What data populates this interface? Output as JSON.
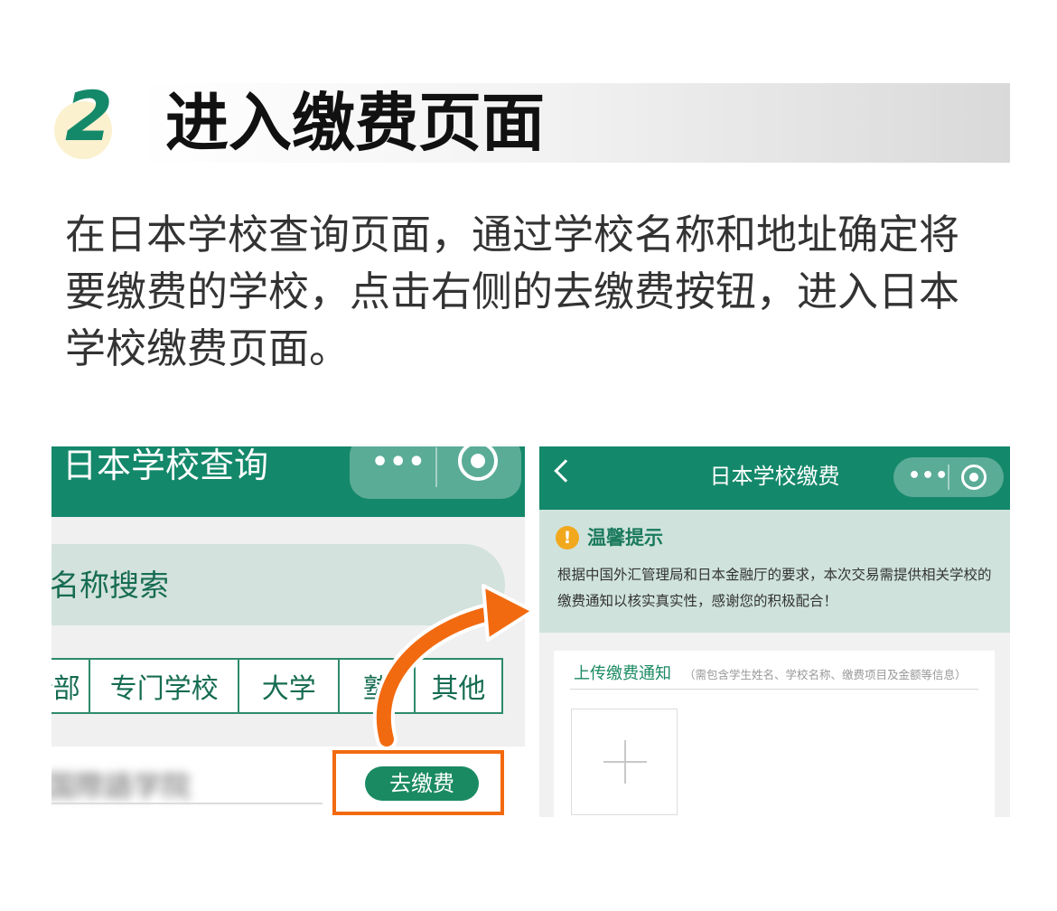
{
  "step": {
    "number": "2",
    "title": "进入缴费页面"
  },
  "description": "在日本学校查询页面，通过学校名称和地址确定将要缴费的学校，点击右侧的去缴费按钮，进入日本学校缴费页面。",
  "left_screen": {
    "title": "日本学校查询",
    "search_label": "名称搜索",
    "categories": [
      "全部",
      "专门学校",
      "大学",
      "塾",
      "其他"
    ],
    "school_name": "国際語学院",
    "pay_button": "去缴费"
  },
  "right_screen": {
    "title": "日本学校缴费",
    "notice_icon": "!",
    "notice_title": "温馨提示",
    "notice_body": "根据中国外汇管理局和日本金融厅的要求，本次交易需提供相关学校的缴费通知以核实真实性，感谢您的积极配合！",
    "upload_label": "上传缴费通知",
    "upload_hint": "（需包含学生姓名、学校名称、缴费项目及金额等信息）"
  },
  "capsule_dots": "•••",
  "colors": {
    "brand_green": "#14886a",
    "highlight_orange": "#f26a0f",
    "notice_bg": "#cfe3dc",
    "warning_yellow": "#f2a81d"
  },
  "icons": [
    "more-dots-icon",
    "close-target-icon",
    "back-chevron-icon",
    "warning-icon",
    "plus-icon",
    "curved-arrow-icon"
  ]
}
